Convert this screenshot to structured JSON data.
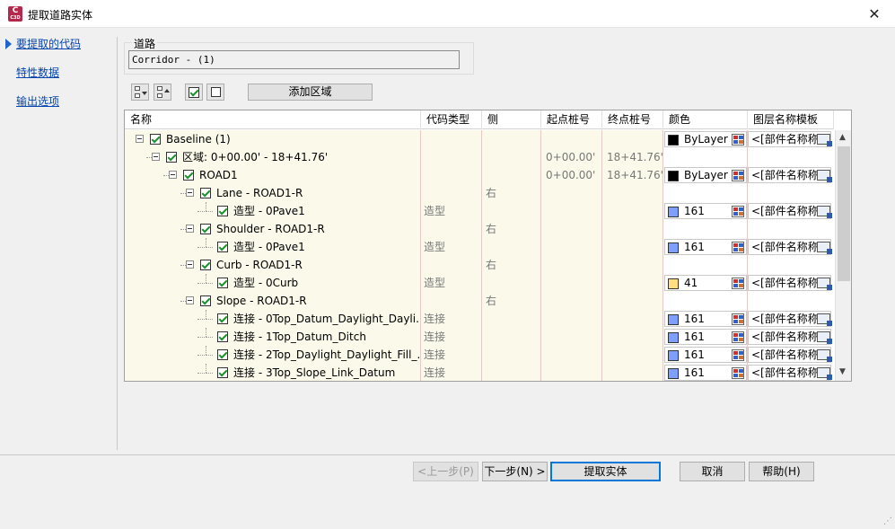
{
  "window": {
    "title": "提取道路实体",
    "app_icon_text": "C",
    "app_icon_sub": "C3D",
    "close_glyph": "✕"
  },
  "nav": {
    "items": [
      {
        "label": "要提取的代码",
        "active": true
      },
      {
        "label": "特性数据",
        "active": false
      },
      {
        "label": "输出选项",
        "active": false
      }
    ]
  },
  "road": {
    "group_label": "道路",
    "value": "Corridor - (1)"
  },
  "toolbar": {
    "add_region_label": "添加区域"
  },
  "grid": {
    "headers": [
      "名称",
      "代码类型",
      "侧",
      "起点桩号",
      "终点桩号",
      "颜色",
      "图层名称模板"
    ],
    "rows": [
      {
        "name": "Baseline (1)",
        "code_type": "",
        "side": "",
        "start": "",
        "end": "",
        "color": "ByLayer",
        "swatch": "#000000",
        "template": "<[部件名称称...",
        "level": 0,
        "expander": true
      },
      {
        "name": "区域: 0+00.00' - 18+41.76'",
        "code_type": "",
        "side": "",
        "start": "0+00.00'",
        "end": "18+41.76'",
        "color": "",
        "swatch": "",
        "template": "",
        "level": 1,
        "expander": true
      },
      {
        "name": "ROAD1",
        "code_type": "",
        "side": "",
        "start": "0+00.00'",
        "end": "18+41.76'",
        "color": "ByLayer",
        "swatch": "#000000",
        "template": "<[部件名称称...",
        "level": 2,
        "expander": true
      },
      {
        "name": "Lane - ROAD1-R",
        "code_type": "",
        "side": "右",
        "start": "",
        "end": "",
        "color": "",
        "swatch": "",
        "template": "",
        "level": 3,
        "expander": true
      },
      {
        "name": "造型 - 0Pave1",
        "code_type": "造型",
        "side": "",
        "start": "",
        "end": "",
        "color": "161",
        "swatch": "#7f9fff",
        "template": "<[部件名称称...",
        "level": 4,
        "expander": false
      },
      {
        "name": "Shoulder - ROAD1-R",
        "code_type": "",
        "side": "右",
        "start": "",
        "end": "",
        "color": "",
        "swatch": "",
        "template": "",
        "level": 3,
        "expander": true
      },
      {
        "name": "造型 - 0Pave1",
        "code_type": "造型",
        "side": "",
        "start": "",
        "end": "",
        "color": "161",
        "swatch": "#7f9fff",
        "template": "<[部件名称称...",
        "level": 4,
        "expander": false
      },
      {
        "name": "Curb - ROAD1-R",
        "code_type": "",
        "side": "右",
        "start": "",
        "end": "",
        "color": "",
        "swatch": "",
        "template": "",
        "level": 3,
        "expander": true
      },
      {
        "name": "造型 - 0Curb",
        "code_type": "造型",
        "side": "",
        "start": "",
        "end": "",
        "color": "41",
        "swatch": "#ffdf7f",
        "template": "<[部件名称称...",
        "level": 4,
        "expander": false
      },
      {
        "name": "Slope - ROAD1-R",
        "code_type": "",
        "side": "右",
        "start": "",
        "end": "",
        "color": "",
        "swatch": "",
        "template": "",
        "level": 3,
        "expander": true
      },
      {
        "name": "连接 - 0Top_Datum_Daylight_Dayli...",
        "code_type": "连接",
        "side": "",
        "start": "",
        "end": "",
        "color": "161",
        "swatch": "#7f9fff",
        "template": "<[部件名称称...",
        "level": 4,
        "expander": false
      },
      {
        "name": "连接 - 1Top_Datum_Ditch",
        "code_type": "连接",
        "side": "",
        "start": "",
        "end": "",
        "color": "161",
        "swatch": "#7f9fff",
        "template": "<[部件名称称...",
        "level": 4,
        "expander": false
      },
      {
        "name": "连接 - 2Top_Daylight_Daylight_Fill_...",
        "code_type": "连接",
        "side": "",
        "start": "",
        "end": "",
        "color": "161",
        "swatch": "#7f9fff",
        "template": "<[部件名称称...",
        "level": 4,
        "expander": false
      },
      {
        "name": "连接 - 3Top_Slope_Link_Datum",
        "code_type": "连接",
        "side": "",
        "start": "",
        "end": "",
        "color": "161",
        "swatch": "#7f9fff",
        "template": "<[部件名称称...",
        "level": 4,
        "expander": false
      }
    ]
  },
  "buttons": {
    "prev": "<上一步(P)",
    "next": "下一步(N) >",
    "extract": "提取实体",
    "cancel": "取消",
    "help": "帮助(H)"
  }
}
